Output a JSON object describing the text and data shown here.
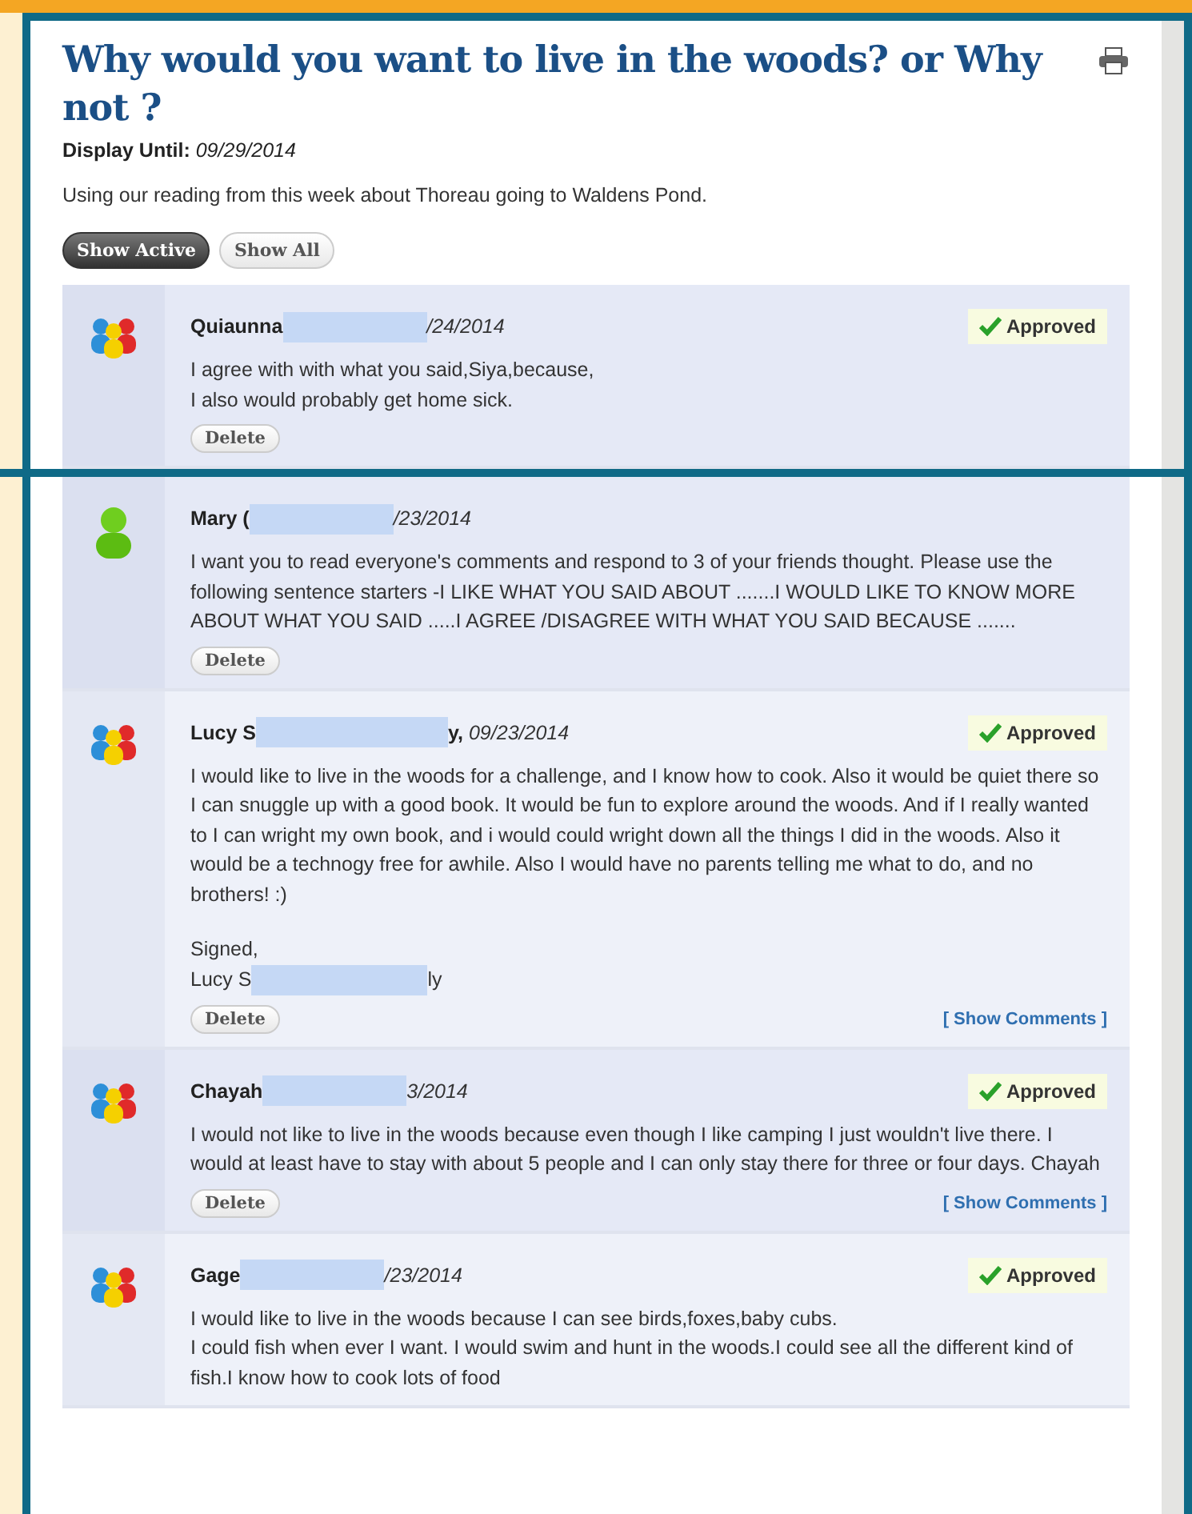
{
  "title": "Why would you want to live in the woods? or Why not ?",
  "display_until": {
    "label": "Display Until:",
    "value": "09/29/2014"
  },
  "description": "Using our reading from this week about Thoreau going to Waldens Pond.",
  "filters": [
    {
      "label": "Show Active",
      "selected": true
    },
    {
      "label": "Show All",
      "selected": false
    }
  ],
  "comments": [
    {
      "kind": "group",
      "name": "Quiaunna",
      "date": "/24/2014",
      "approved": true,
      "approved_label": "Approved",
      "paragraphs": [
        [
          {
            "text": "I agree with with what you said,Siya,because,"
          },
          {
            "text": "I also would probably get home sick."
          }
        ]
      ],
      "delete_label": "Delete"
    },
    {
      "kind": "single",
      "name": "Mary (",
      "date": "/23/2014",
      "approved": false,
      "paragraphs": [
        [
          {
            "text": "I want you to read everyone's comments and respond to 3 of your friends thought. Please use the following sentence starters -I LIKE WHAT YOU SAID ABOUT .......I WOULD LIKE TO KNOW MORE ABOUT WHAT YOU SAID .....I AGREE /DISAGREE WITH WHAT YOU SAID BECAUSE ......."
          }
        ]
      ],
      "delete_label": "Delete"
    },
    {
      "kind": "group",
      "name": "Lucy S",
      "name_tail": "y,",
      "date": "09/23/2014",
      "approved": true,
      "approved_label": "Approved",
      "paragraphs": [
        [
          {
            "text": "I would like to live in the woods for a challenge, and I know how to cook. Also it would be quiet there so I can snuggle up with a good book. It would be fun to explore around the woods. And if I really wanted to I can wright my own book, and i would could wright down all the things I did in the woods. Also it would be a technogy free for awhile. Also I would have no parents telling me what to do, and no brothers! :)"
          }
        ],
        [
          {
            "text": "Signed,"
          },
          {
            "text": "Lucy S",
            "tail": "ly"
          }
        ]
      ],
      "delete_label": "Delete",
      "show_comments": "[ Show Comments ]"
    },
    {
      "kind": "group",
      "name": "Chayah",
      "date": "3/2014",
      "approved": true,
      "approved_label": "Approved",
      "paragraphs": [
        [
          {
            "text": "I would not like to live in the woods because even though I like camping I just wouldn't live there. I would at least have to stay with about 5 people and I can only stay there for three or four days. Chayah"
          }
        ]
      ],
      "delete_label": "Delete",
      "show_comments": "[ Show Comments ]"
    },
    {
      "kind": "group",
      "name": "Gage",
      "date": "/23/2014",
      "approved": true,
      "approved_label": "Approved",
      "paragraphs": [
        [
          {
            "text": "I would like to live in the woods because I can see birds,foxes,baby cubs."
          },
          {
            "text": "I could fish when ever I want. I would swim and hunt in the woods.I could see all the different kind of fish.I know how to cook lots of food"
          }
        ]
      ]
    }
  ]
}
